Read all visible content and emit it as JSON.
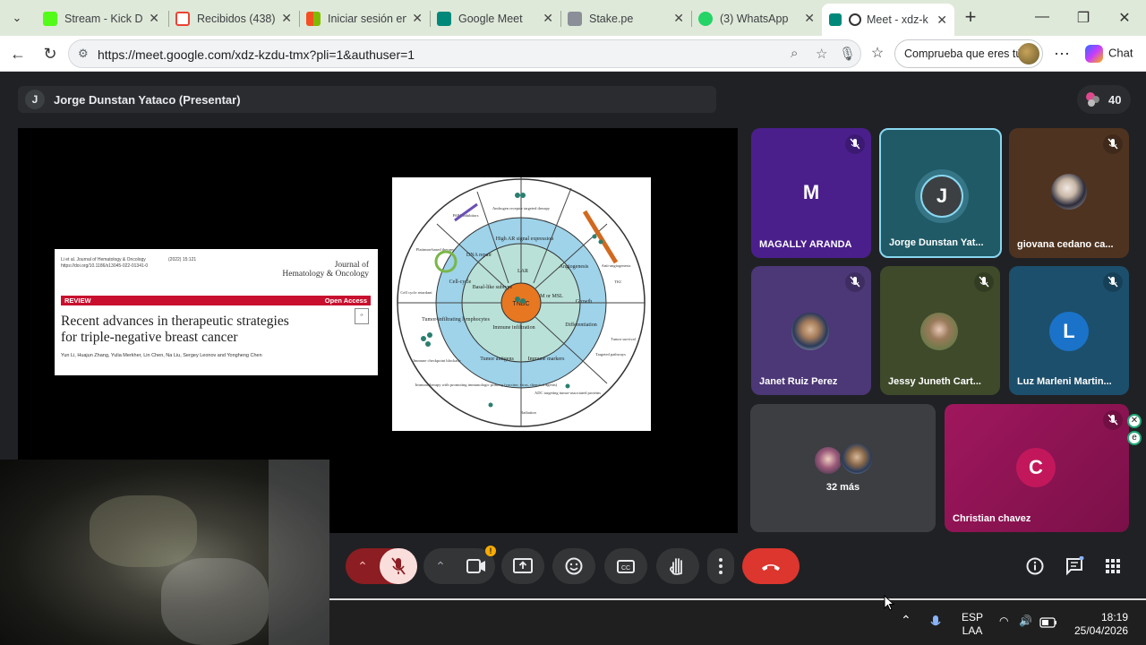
{
  "browser": {
    "tabs": [
      {
        "label": "Stream - Kick Da",
        "favicon_color": "#53fc18"
      },
      {
        "label": "Recibidos (438)",
        "favicon_color": "#ea4335"
      },
      {
        "label": "Iniciar sesión en",
        "favicon_color": "#f25022"
      },
      {
        "label": "Google Meet",
        "favicon_color": "#00897b"
      },
      {
        "label": "Stake.pe",
        "favicon_color": "#8a8f98"
      },
      {
        "label": "(3) WhatsApp",
        "favicon_color": "#25d366"
      },
      {
        "label": "Meet - xdz-k",
        "favicon_color": "#00897b"
      }
    ],
    "url": "https://meet.google.com/xdz-kzdu-tmx?pli=1&authuser=1",
    "profile_label": "Comprueba que eres tú",
    "chat_label": "Chat"
  },
  "meet": {
    "presenter": "Jorge Dunstan Yataco (Presentar)",
    "presenter_initial": "J",
    "participant_count": "40",
    "slide": {
      "journal_line": "Li et al. Journal of Hematology & Oncology",
      "journal_year": "(2022) 15:121",
      "doi": "https://doi.org/10.1186/s13045-022-01341-0",
      "journal_name_1": "Journal of",
      "journal_name_2": "Hematology & Oncology",
      "review": "REVIEW",
      "open_access": "Open Access",
      "title_1": "Recent advances in therapeutic strategies",
      "title_2": "for triple-negative breast cancer",
      "authors": "Yun Li, Huajun Zhang, Yulia Merkher, Lin Chen, Na Liu, Sergey Leonov and Yongheng Chen"
    },
    "figure": {
      "center": "TNBC",
      "inner": [
        "LAR",
        "M or MSL",
        "Immune infiltration",
        "Basal-like subtype"
      ],
      "middle": [
        "High AR signal expression",
        "Angiogenesis",
        "Growth",
        "Differentiation",
        "Immune markers",
        "Tumor antigens",
        "Tumor-infiltrating lymphocytes",
        "Cell-cycle",
        "DNA repair"
      ],
      "outer": [
        "Androgen receptor targeted therapy",
        "Anti-angiogenesis",
        "TKI",
        "Targeted pathways",
        "ADC targeting tumor-associated proteins",
        "Radiation",
        "Immunotherapy with promoting immunologic priming (vaccine, virus, chemical agents)",
        "Immune checkpoint blockade",
        "Cell cycle retardant",
        "Platinum-based therapy",
        "PARP inhibitors",
        "Tumor survival"
      ]
    },
    "tiles": [
      {
        "name": "MAGALLY ARANDA",
        "initial": "M",
        "color": "#4a1f8c"
      },
      {
        "name": "Jorge Dunstan Yat...",
        "initial": "J",
        "color": "#1f5a66"
      },
      {
        "name": "giovana cedano ca...",
        "initial": "",
        "color": "#4e3320"
      },
      {
        "name": "Janet Ruiz Perez",
        "initial": "",
        "color": "#4c3777"
      },
      {
        "name": "Jessy Juneth Cart...",
        "initial": "",
        "color": "#3e4a2a"
      },
      {
        "name": "Luz Marleni Martin...",
        "initial": "L",
        "color": "#1c4f6c"
      },
      {
        "name": "32 más",
        "initial": "",
        "color": "#3c3e42"
      },
      {
        "name": "Christian chavez",
        "initial": "C",
        "color": "#8c1350"
      }
    ]
  },
  "taskbar": {
    "lang_1": "ESP",
    "lang_2": "LAA",
    "time": "18:19",
    "date": "25/04/2026"
  }
}
